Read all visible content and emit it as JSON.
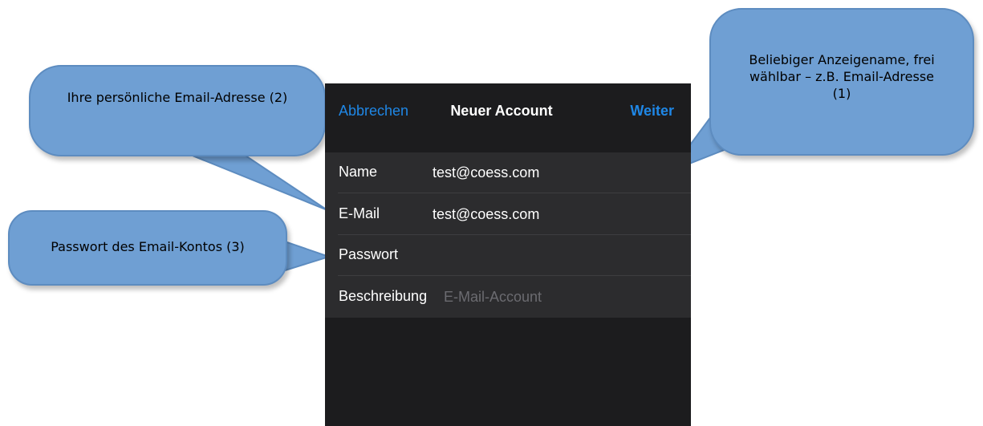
{
  "navbar": {
    "cancel_label": "Abbrechen",
    "title": "Neuer Account",
    "next_label": "Weiter"
  },
  "form": {
    "rows": [
      {
        "label": "Name",
        "value": "test@coess.com"
      },
      {
        "label": "E-Mail",
        "value": "test@coess.com"
      },
      {
        "label": "Passwort",
        "value": ""
      },
      {
        "label": "Beschreibung",
        "placeholder": "E-Mail-Account"
      }
    ]
  },
  "callouts": {
    "display_name": "Beliebiger Anzeigename, frei wählbar – z.B. Email-Adresse (1)",
    "email_address": "Ihre persönliche Email-Adresse (2)",
    "password": "Passwort des Email-Kontos (3)"
  },
  "colors": {
    "accent": "#1f87e6",
    "screen_bg": "#1c1c1e",
    "cell_bg": "#2c2c2e",
    "callout_fill": "#6f9fd3"
  }
}
